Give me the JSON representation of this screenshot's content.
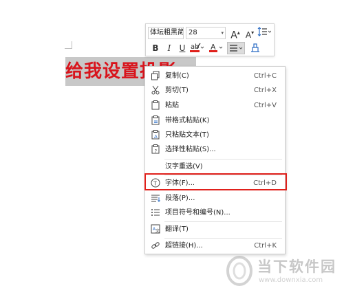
{
  "document": {
    "selected_text": "给我设置投影"
  },
  "mini_toolbar": {
    "font_name": "体坛粗黑简",
    "font_size": "28",
    "grow_font_label": "A",
    "shrink_font_label": "A",
    "bold_label": "B",
    "italic_label": "I",
    "underline_label": "U",
    "font_color_label": "A"
  },
  "context_menu": {
    "items": [
      {
        "label": "复制(C)",
        "shortcut": "Ctrl+C",
        "icon": "copy-icon"
      },
      {
        "label": "剪切(T)",
        "shortcut": "Ctrl+X",
        "icon": "scissors-icon"
      },
      {
        "label": "粘贴",
        "shortcut": "Ctrl+V",
        "icon": "paste-icon"
      },
      {
        "label": "带格式粘贴(K)",
        "shortcut": "",
        "icon": "paste-formatted-icon"
      },
      {
        "label": "只粘贴文本(T)",
        "shortcut": "",
        "icon": "paste-text-icon"
      },
      {
        "label": "选择性粘贴(S)...",
        "shortcut": "",
        "icon": "paste-special-icon"
      },
      {
        "label": "汉字重选(V)",
        "shortcut": "",
        "icon": ""
      },
      {
        "label": "字体(F)...",
        "shortcut": "Ctrl+D",
        "icon": "font-icon"
      },
      {
        "label": "段落(P)...",
        "shortcut": "",
        "icon": "paragraph-icon"
      },
      {
        "label": "项目符号和编号(N)...",
        "shortcut": "",
        "icon": "bullets-icon"
      },
      {
        "label": "翻译(T)",
        "shortcut": "",
        "icon": "translate-icon"
      },
      {
        "label": "超链接(H)...",
        "shortcut": "Ctrl+K",
        "icon": "link-icon"
      }
    ]
  },
  "watermark": {
    "brand": "当下软件园",
    "url": "www.downxia.com"
  },
  "colors": {
    "selected_text": "#d8141c",
    "selection_bg": "#c8c8c8",
    "highlight_box": "#e0201b",
    "font_color_bar": "#e0201b",
    "highlight_pen_bar": "#e0201b"
  }
}
